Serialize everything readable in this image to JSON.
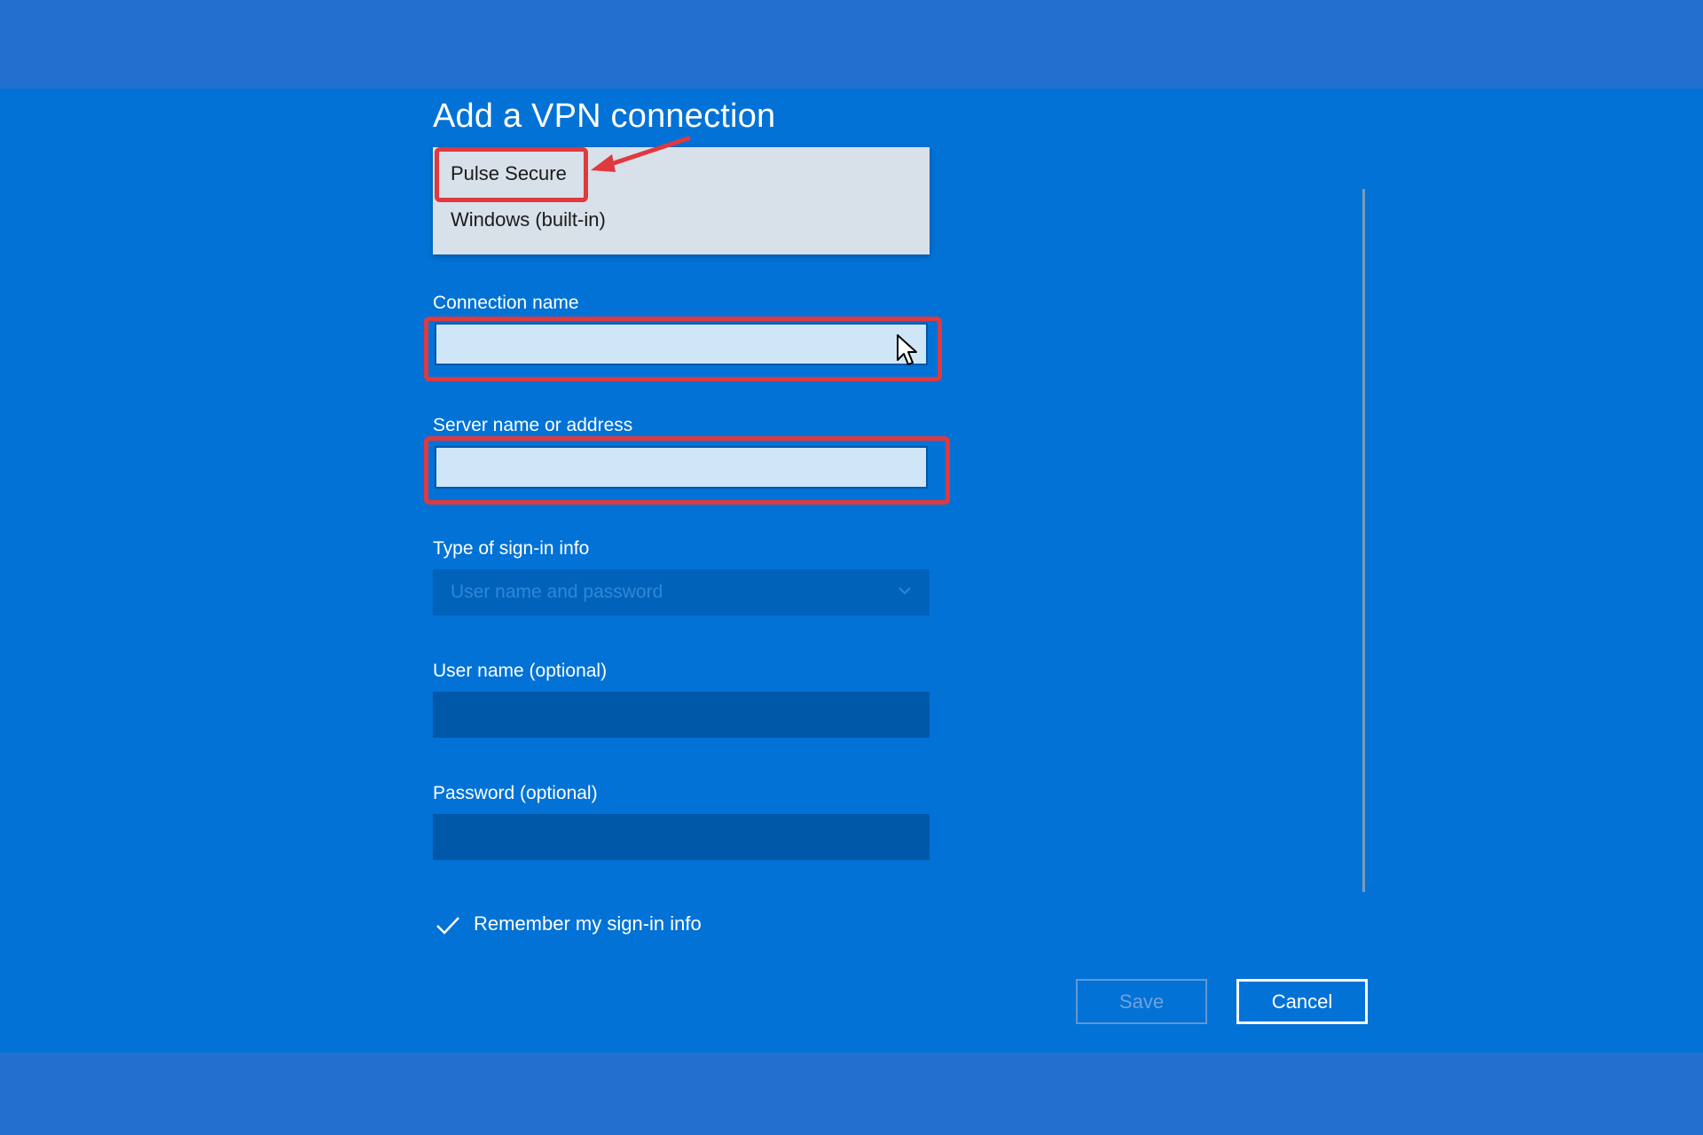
{
  "dialog": {
    "title": "Add a VPN connection"
  },
  "vpn_provider": {
    "options": [
      "Pulse Secure",
      "Windows (built-in)"
    ],
    "highlighted": "Pulse Secure"
  },
  "fields": {
    "connection_name": {
      "label": "Connection name",
      "value": ""
    },
    "server": {
      "label": "Server name or address",
      "value": ""
    },
    "sign_in_type": {
      "label": "Type of sign-in info",
      "value": "User name and password"
    },
    "username": {
      "label": "User name (optional)",
      "value": ""
    },
    "password": {
      "label": "Password (optional)",
      "value": ""
    }
  },
  "remember": {
    "label": "Remember my sign-in info",
    "checked": true
  },
  "buttons": {
    "save": "Save",
    "cancel": "Cancel"
  },
  "colors": {
    "dialog_bg": "#0272d6",
    "backdrop": "#236fd0",
    "highlight": "#e0393e",
    "input_bg": "#cfe6f8",
    "dark_input": "#0058a8"
  },
  "icons": [
    "chevron-down-icon",
    "checkmark-icon",
    "pointer-arrow-icon",
    "mouse-cursor-icon"
  ]
}
